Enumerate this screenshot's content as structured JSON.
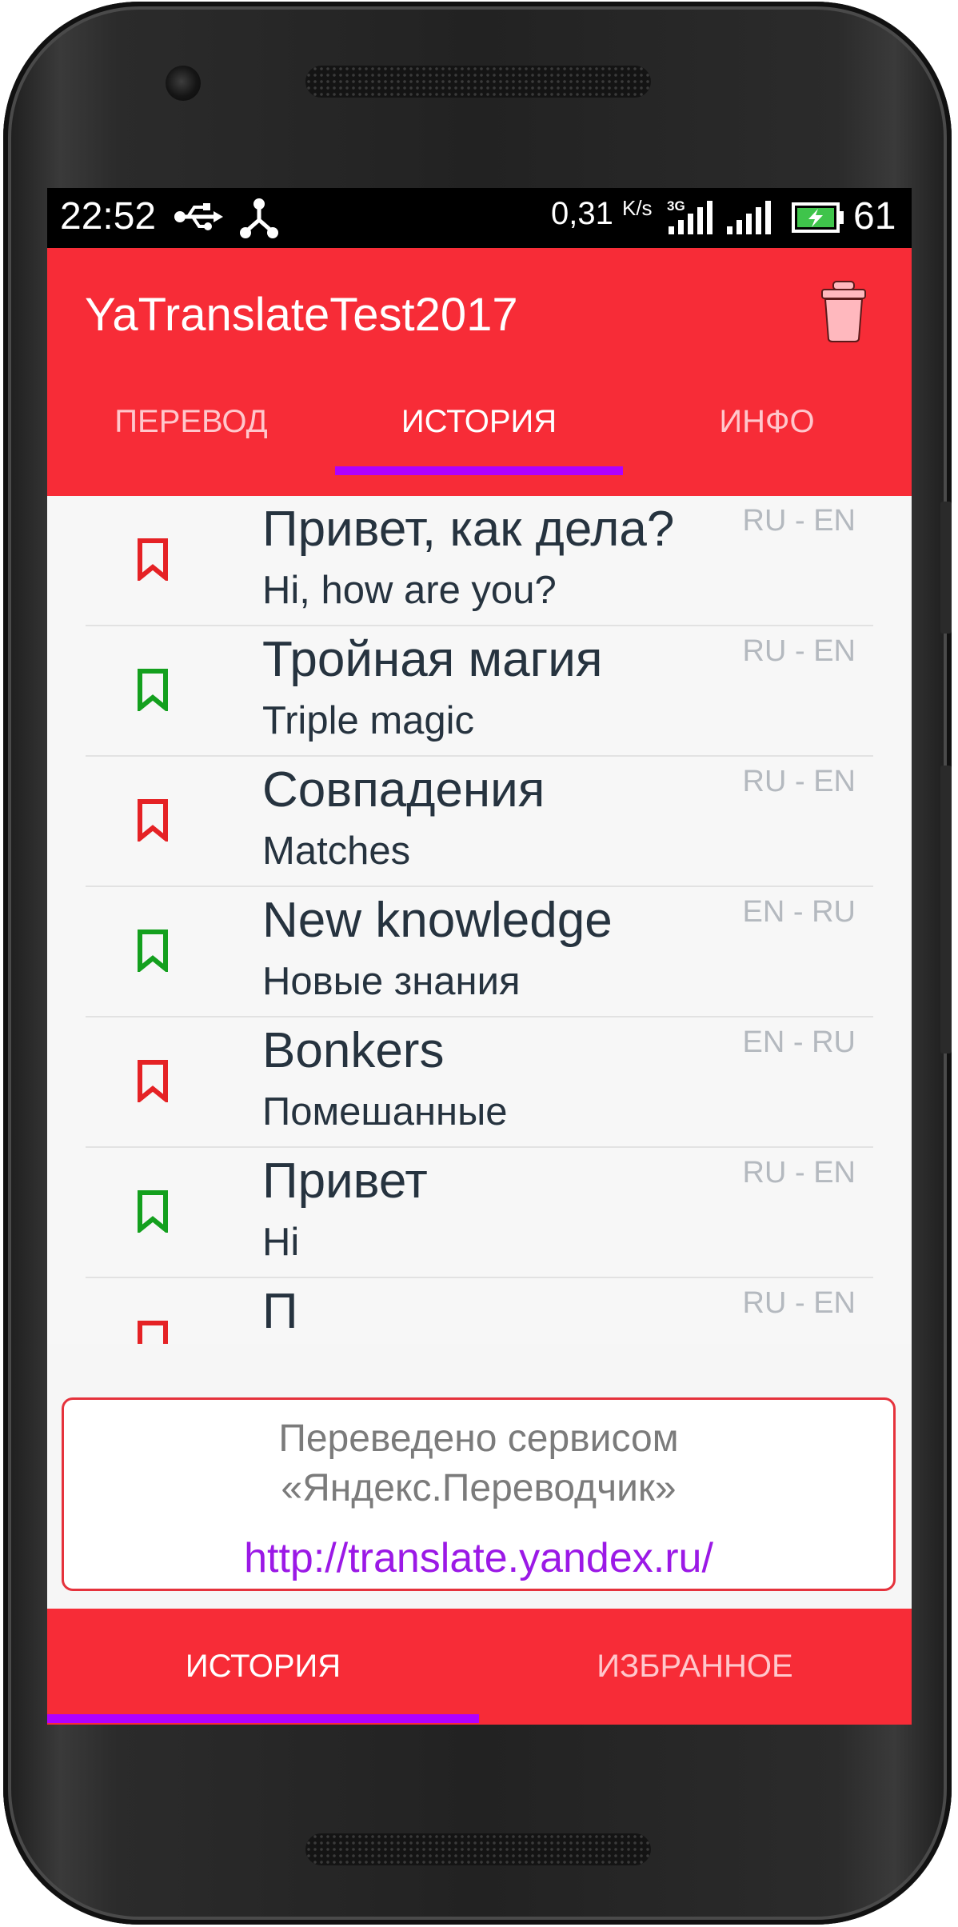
{
  "status_bar": {
    "time": "22:52",
    "net_speed": "0,31",
    "net_speed_unit": "K/s",
    "network_type": "3G",
    "battery_level": "61",
    "icons": [
      "usb-icon",
      "share-icon",
      "signal-3g-icon",
      "signal-icon",
      "battery-charging-icon"
    ]
  },
  "app_bar": {
    "title": "YaTranslateTest2017",
    "action_icon": "trash-icon",
    "color": "#f72c37"
  },
  "tabs": [
    {
      "label": "ПЕРЕВОД",
      "active": false
    },
    {
      "label": "ИСТОРИЯ",
      "active": true
    },
    {
      "label": "ИНФО",
      "active": false
    }
  ],
  "history": [
    {
      "source": "Привет, как дела?",
      "target": "Hi, how are you?",
      "lang": "RU - EN",
      "bookmark_color": "#e52225"
    },
    {
      "source": "Тройная магия",
      "target": "Triple magic",
      "lang": "RU - EN",
      "bookmark_color": "#14a01e"
    },
    {
      "source": "Совпадения",
      "target": "Matches",
      "lang": "RU - EN",
      "bookmark_color": "#e52225"
    },
    {
      "source": "New knowledge",
      "target": "Новые знания",
      "lang": "EN - RU",
      "bookmark_color": "#14a01e"
    },
    {
      "source": "Bonkers",
      "target": "Помешанные",
      "lang": "EN - RU",
      "bookmark_color": "#e52225"
    },
    {
      "source": "Привет",
      "target": "Hi",
      "lang": "RU - EN",
      "bookmark_color": "#14a01e"
    },
    {
      "source": "П",
      "target": "",
      "lang": "RU - EN",
      "bookmark_color": "#e52225"
    }
  ],
  "credit": {
    "line1": "Переведено сервисом",
    "line2": "«Яндекс.Переводчик»",
    "link": "http://translate.yandex.ru/"
  },
  "bottom_tabs": [
    {
      "label": "ИСТОРИЯ",
      "active": true
    },
    {
      "label": "ИЗБРАННОЕ",
      "active": false
    }
  ],
  "colors": {
    "primary": "#f72c37",
    "indicator": "#b000ff",
    "bookmark_red": "#e52225",
    "bookmark_green": "#14a01e",
    "link": "#9b19e6"
  }
}
